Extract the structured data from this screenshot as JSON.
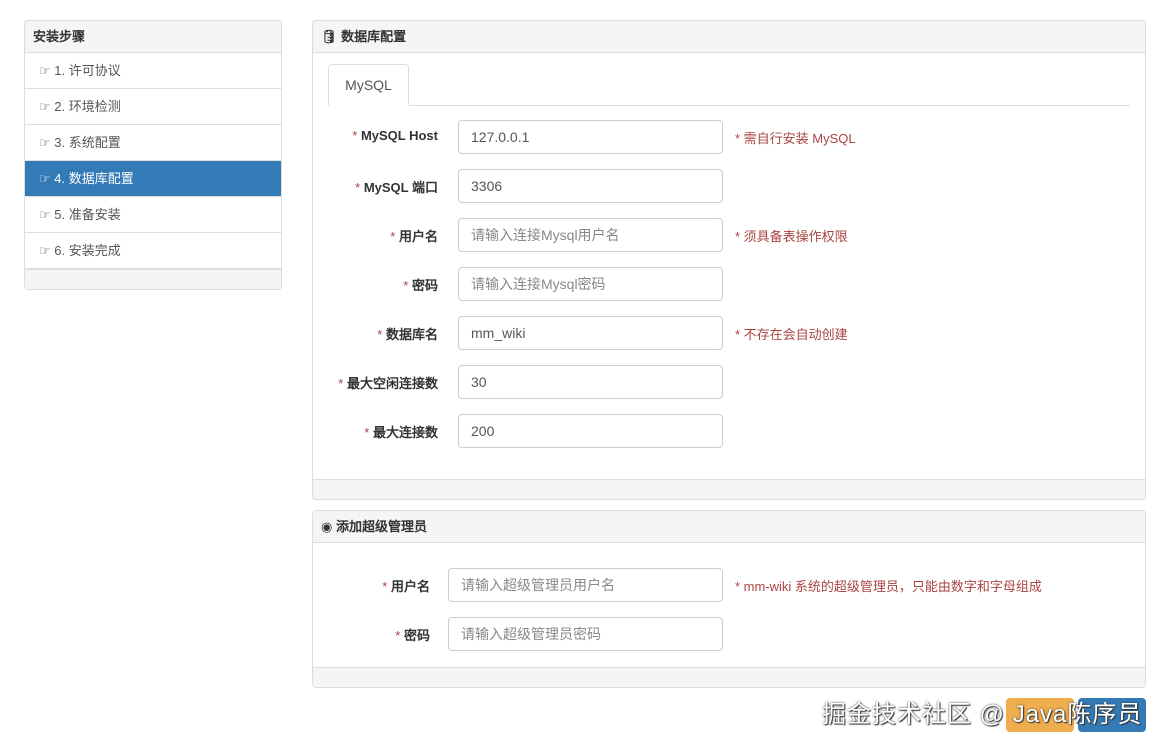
{
  "sidebar": {
    "title": "安装步骤",
    "steps": [
      "1. 许可协议",
      "2. 环境检测",
      "3. 系统配置",
      "4. 数据库配置",
      "5. 准备安装",
      "6. 安装完成"
    ],
    "active_index": 3
  },
  "db": {
    "title": "数据库配置",
    "tab": "MySQL",
    "fields": [
      {
        "label": "MySQL Host",
        "value": "127.0.0.1",
        "placeholder": "",
        "hint": "* 需自行安装 MySQL"
      },
      {
        "label": "MySQL 端口",
        "value": "3306",
        "placeholder": "",
        "hint": ""
      },
      {
        "label": "用户名",
        "value": "",
        "placeholder": "请输入连接Mysql用户名",
        "hint": "* 须具备表操作权限"
      },
      {
        "label": "密码",
        "value": "",
        "placeholder": "请输入连接Mysql密码",
        "hint": ""
      },
      {
        "label": "数据库名",
        "value": "mm_wiki",
        "placeholder": "",
        "hint": "* 不存在会自动创建"
      },
      {
        "label": "最大空闲连接数",
        "value": "30",
        "placeholder": "",
        "hint": ""
      },
      {
        "label": "最大连接数",
        "value": "200",
        "placeholder": "",
        "hint": ""
      }
    ]
  },
  "admin": {
    "title": "添加超级管理员",
    "fields": [
      {
        "label": "用户名",
        "value": "",
        "placeholder": "请输入超级管理员用户名",
        "hint": "* mm-wiki 系统的超级管理员，只能由数字和字母组成"
      },
      {
        "label": "密码",
        "value": "",
        "placeholder": "请输入超级管理员密码",
        "hint": ""
      }
    ]
  },
  "star": "*",
  "watermark": "掘金技术社区 @ Java陈序员",
  "colors": {
    "primary": "#337ab7",
    "warning": "#f0ad4e",
    "error": "#a94442"
  }
}
